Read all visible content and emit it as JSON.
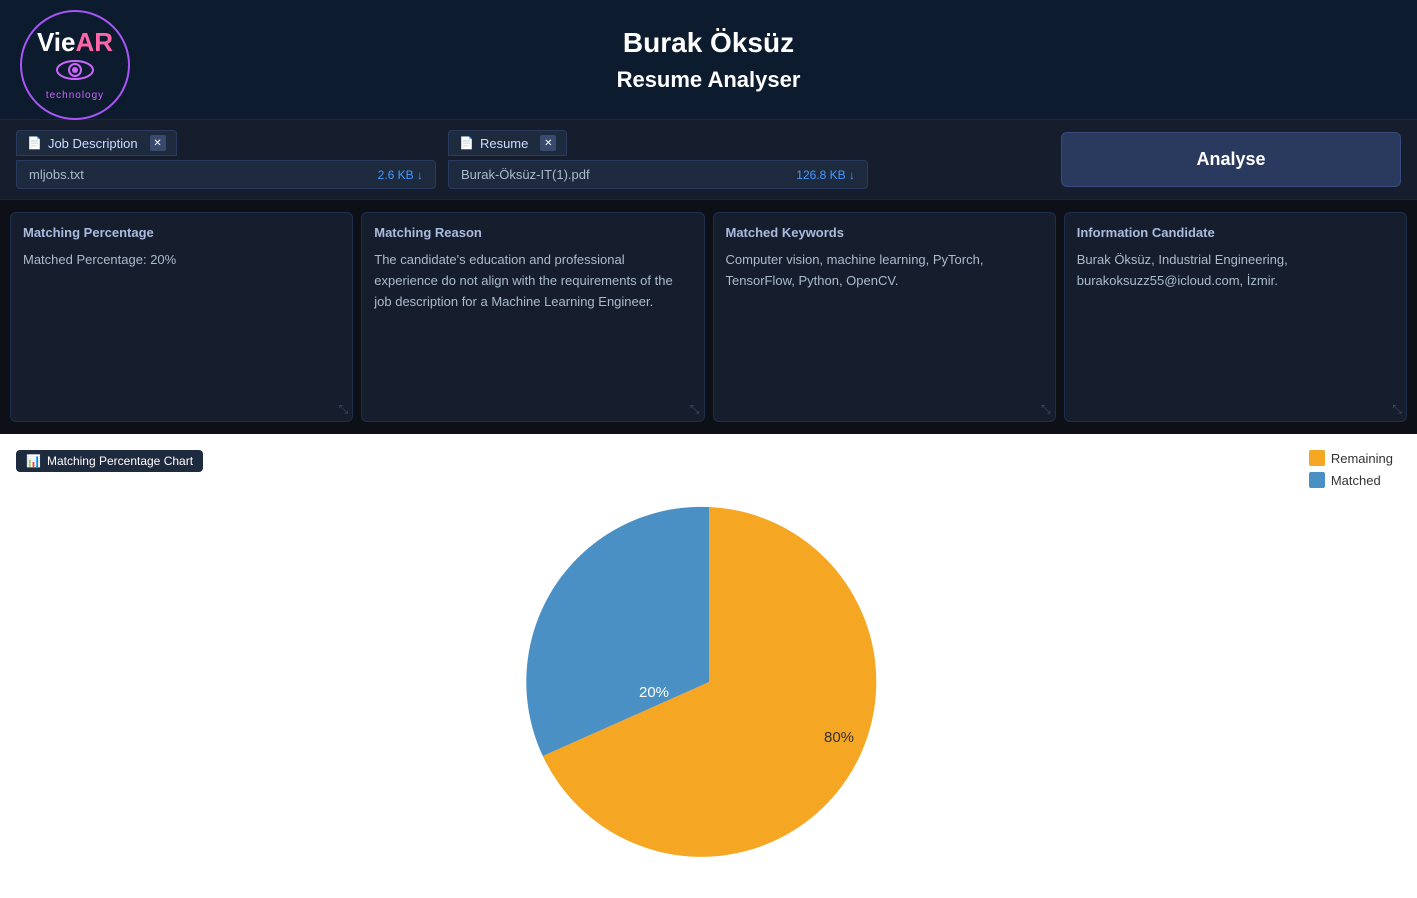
{
  "header": {
    "name": "Burak Öksüz",
    "subtitle": "Resume Analyser",
    "logo_text_vie": "Vie",
    "logo_text_ar": "AR",
    "logo_sub": "technology"
  },
  "upload": {
    "job_tab_label": "Job Description",
    "resume_tab_label": "Resume",
    "job_filename": "mljobs.txt",
    "job_filesize": "2.6 KB ↓",
    "resume_filename": "Burak-Öksüz-IT(1).pdf",
    "resume_filesize": "126.8 KB ↓",
    "analyse_label": "Analyse"
  },
  "cards": {
    "matching_percentage": {
      "title": "Matching Percentage",
      "content": "Matched Percentage: 20%"
    },
    "matching_reason": {
      "title": "Matching Reason",
      "content": "The candidate's education and professional experience do not align with the requirements of the job description for a Machine Learning Engineer."
    },
    "matched_keywords": {
      "title": "Matched Keywords",
      "content": "Computer vision, machine learning, PyTorch, TensorFlow, Python, OpenCV."
    },
    "information_candidate": {
      "title": "Information Candidate",
      "content": "Burak Öksüz, Industrial Engineering, burakoksuzz55@icloud.com, İzmir."
    }
  },
  "chart": {
    "title": "Matching Percentage Chart",
    "legend": {
      "remaining_label": "Remaining",
      "matched_label": "Matched"
    },
    "matched_pct": 20,
    "remaining_pct": 80,
    "matched_color": "#4a90c4",
    "remaining_color": "#f5a623",
    "matched_label_pos": "20%",
    "remaining_label_pos": "80%"
  }
}
